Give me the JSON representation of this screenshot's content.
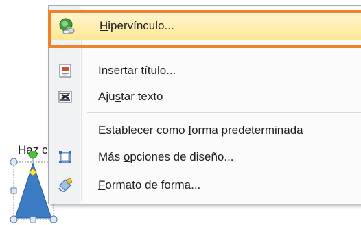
{
  "backdrop": {
    "partial_text": "Haz c"
  },
  "context_menu": {
    "items": [
      {
        "pre": "",
        "ul": "H",
        "post": "ipervínculo...",
        "icon": "hyperlink-globe-icon"
      },
      {
        "pre": "Insertar tít",
        "ul": "u",
        "post": "lo...",
        "icon": "insert-caption-icon"
      },
      {
        "pre": "Aju",
        "ul": "s",
        "post": "tar texto",
        "icon": "wrap-text-icon"
      },
      {
        "pre": "Establecer como ",
        "ul": "f",
        "post": "orma predeterminada",
        "icon": ""
      },
      {
        "pre": "Más ",
        "ul": "o",
        "post": "pciones de diseño...",
        "icon": "layout-options-icon"
      },
      {
        "pre": "",
        "ul": "F",
        "post": "ormato de forma...",
        "icon": "format-shape-icon"
      }
    ]
  },
  "colors": {
    "highlight_border": "#f0832a",
    "hover_fill": "#fde794",
    "shape_fill": "#3b7cc4",
    "handle_green": "#4cbf3d"
  }
}
